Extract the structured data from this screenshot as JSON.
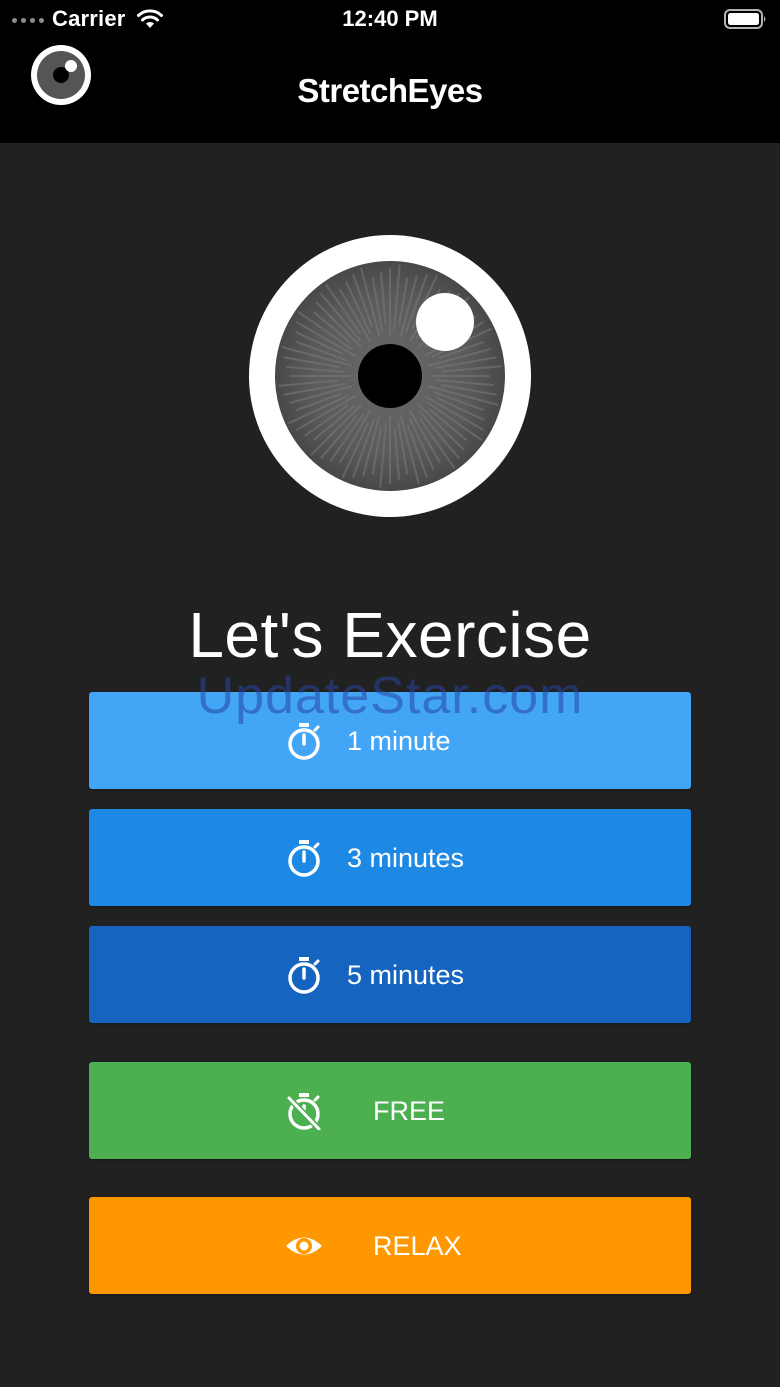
{
  "status_bar": {
    "carrier": "Carrier",
    "time": "12:40 PM"
  },
  "nav": {
    "title": "StretchEyes",
    "logo_icon": "eye-logo-icon"
  },
  "main": {
    "heading": "Let's Exercise",
    "watermark": "UpdateStar.com",
    "buttons": [
      {
        "label": "1 minute",
        "icon": "stopwatch-icon",
        "color": "#42a5f5"
      },
      {
        "label": "3 minutes",
        "icon": "stopwatch-icon",
        "color": "#1e88e5"
      },
      {
        "label": "5 minutes",
        "icon": "stopwatch-icon",
        "color": "#1565c0"
      },
      {
        "label": "FREE",
        "icon": "timer-off-icon",
        "color": "#4caf50"
      },
      {
        "label": "RELAX",
        "icon": "eye-icon",
        "color": "#ff9800"
      }
    ]
  },
  "colors": {
    "background": "#212121",
    "topbar": "#000000"
  }
}
